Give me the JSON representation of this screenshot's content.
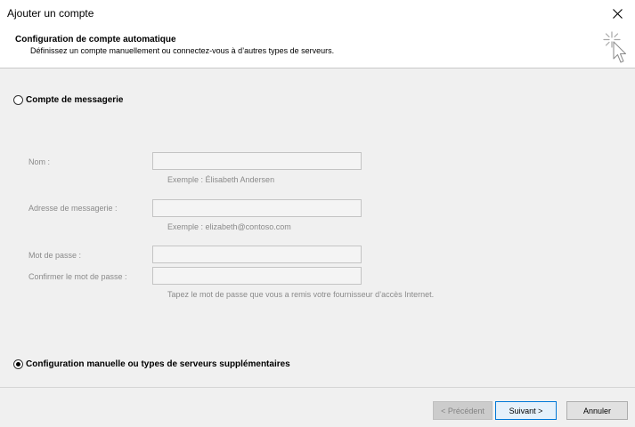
{
  "window": {
    "title": "Ajouter un compte"
  },
  "header": {
    "title": "Configuration de compte automatique",
    "subtitle": "Définissez un compte manuellement ou connectez-vous à d’autres types de serveurs.",
    "icon": "cursor-sparkle-icon"
  },
  "email_account_option": {
    "label": "Compte de messagerie",
    "checked": false
  },
  "form": {
    "name": {
      "label": "Nom :",
      "value": "",
      "hint": "Exemple : Élisabeth Andersen"
    },
    "email": {
      "label": "Adresse de messagerie :",
      "value": "",
      "hint": "Exemple : elizabeth@contoso.com"
    },
    "password": {
      "label": "Mot de passe :",
      "value": ""
    },
    "confirm_password": {
      "label": "Confirmer le mot de passe :",
      "value": ""
    },
    "password_hint": "Tapez le mot de passe que vous a remis votre fournisseur d’accès Internet."
  },
  "manual_option": {
    "label": "Configuration manuelle ou types de serveurs supplémentaires",
    "checked": true
  },
  "buttons": {
    "previous": "< Précédent",
    "next": "Suivant >",
    "cancel": "Annuler"
  },
  "colors": {
    "accent": "#0078d7",
    "window_bg": "#f0f0f0",
    "disabled_text": "#8a8a8a"
  }
}
